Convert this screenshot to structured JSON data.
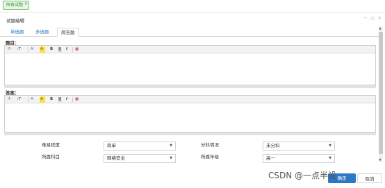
{
  "top_tab": {
    "label": "所有试题",
    "close": "×"
  },
  "window": {
    "title": "试题编辑",
    "controls": "− ◻ ×"
  },
  "tabs": [
    {
      "label": "单选题"
    },
    {
      "label": "多选题"
    },
    {
      "label": "简答题",
      "active": true
    }
  ],
  "question": {
    "label": "题目："
  },
  "answer": {
    "label": "答案："
  },
  "toolbar": {
    "font_family": "ℱ·",
    "font_size": "ₜT·",
    "font_color": "A·",
    "bg_color": "A·",
    "bold": "B",
    "underline": "U",
    "italic": "I",
    "table": "▦"
  },
  "form": {
    "difficulty_label": "难易程度",
    "difficulty_value": "简单",
    "score_label": "分科情况",
    "score_value": "未分科",
    "subject_label": "所属科目",
    "subject_value": "网络安全",
    "grade_label": "所属年级",
    "grade_value": "高一"
  },
  "buttons": {
    "ok": "确定",
    "cancel": "取消"
  },
  "watermark": "CSDN @一点半设",
  "colors": {
    "accent": "#2b78c5",
    "tab_green": "#6cbf6c",
    "highlight": "#ffe23d"
  }
}
